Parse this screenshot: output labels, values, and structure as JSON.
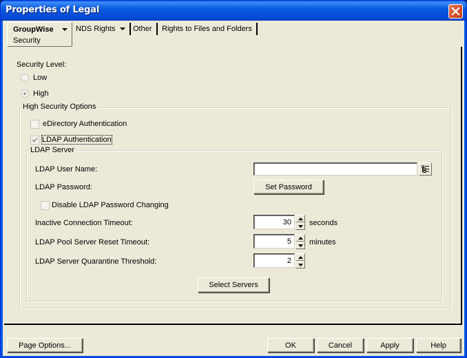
{
  "window": {
    "title": "Properties of Legal",
    "close_icon": "close-icon"
  },
  "tabs": [
    {
      "label": "GroupWise",
      "sublabel": "Security",
      "has_dropdown": true,
      "active": true
    },
    {
      "label": "NDS Rights",
      "has_dropdown": true,
      "active": false
    },
    {
      "label": "Other",
      "has_dropdown": false,
      "active": false
    },
    {
      "label": "Rights to Files and Folders",
      "has_dropdown": false,
      "active": false
    }
  ],
  "security": {
    "level_label": "Security Level:",
    "options": [
      {
        "label": "Low",
        "selected": false
      },
      {
        "label": "High",
        "selected": true
      }
    ],
    "high_options": {
      "legend": "High Security Options",
      "edirectory_auth": {
        "label": "eDirectory Authentication",
        "checked": false
      },
      "ldap_auth": {
        "label": "LDAP Authentication",
        "checked": true
      }
    }
  },
  "ldap_server": {
    "legend": "LDAP Server",
    "user_name": {
      "label": "LDAP User Name:",
      "value": ""
    },
    "password": {
      "label": "LDAP Password:",
      "button": "Set Password"
    },
    "disable_pw_change": {
      "label": "Disable LDAP Password Changing",
      "checked": false
    },
    "inactive_timeout": {
      "label": "Inactive Connection Timeout:",
      "value": "30",
      "unit": "seconds"
    },
    "pool_reset_timeout": {
      "label": "LDAP Pool Server Reset Timeout:",
      "value": "5",
      "unit": "minutes"
    },
    "quarantine_threshold": {
      "label": "LDAP Server Quarantine Threshold:",
      "value": "2",
      "unit": ""
    },
    "select_servers": "Select Servers"
  },
  "footer": {
    "page_options": "Page Options...",
    "ok": "OK",
    "cancel": "Cancel",
    "apply": "Apply",
    "help": "Help"
  }
}
